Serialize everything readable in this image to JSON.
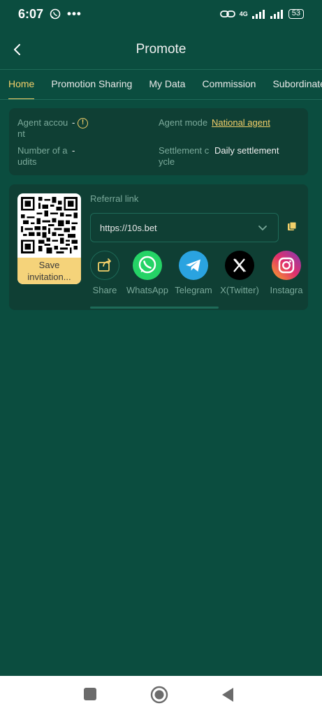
{
  "status_bar": {
    "time": "6:07",
    "dots": "•••",
    "network": "4G",
    "battery": "53"
  },
  "header": {
    "title": "Promote"
  },
  "tabs": [
    {
      "label": "Home",
      "active": true
    },
    {
      "label": "Promotion Sharing"
    },
    {
      "label": "My Data"
    },
    {
      "label": "Commission"
    },
    {
      "label": "Subordinate"
    }
  ],
  "info": {
    "agent_account": {
      "label": "Agent accou nt",
      "value": "-"
    },
    "agent_mode": {
      "label": "Agent mode",
      "value": "National agent"
    },
    "number_of_audits": {
      "label": "Number of a udits",
      "value": "-"
    },
    "settlement_cycle": {
      "label": "Settlement c ycle",
      "value": "Daily settlement"
    }
  },
  "share_card": {
    "qr_save_label": "Save invitation...",
    "referral_label": "Referral link",
    "referral_link": "https://10s.bet",
    "share_options": [
      {
        "label": "Share",
        "icon": "share-icon",
        "color": "#0f3f34"
      },
      {
        "label": "WhatsApp",
        "icon": "whatsapp-icon",
        "color": "#25d366"
      },
      {
        "label": "Telegram",
        "icon": "telegram-icon",
        "color": "#2aa3e0"
      },
      {
        "label": "X(Twitter)",
        "icon": "x-twitter-icon",
        "color": "#000000"
      },
      {
        "label": "Instagra",
        "icon": "instagram-icon",
        "color": "#e1306c"
      }
    ]
  },
  "colors": {
    "background": "#0b4d3f",
    "card": "#0f3f34",
    "accent": "#f3d06a",
    "muted": "#7aa99a"
  }
}
